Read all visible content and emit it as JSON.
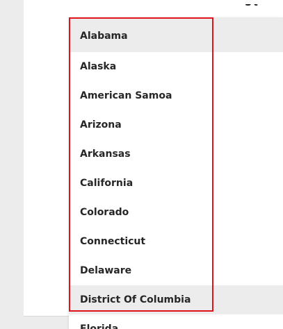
{
  "top_fragment_text": "St",
  "dropdown": {
    "options": [
      {
        "label": "Alabama"
      },
      {
        "label": "Alaska"
      },
      {
        "label": "American Samoa"
      },
      {
        "label": "Arizona"
      },
      {
        "label": "Arkansas"
      },
      {
        "label": "California"
      },
      {
        "label": "Colorado"
      },
      {
        "label": "Connecticut"
      },
      {
        "label": "Delaware"
      },
      {
        "label": "District Of Columbia"
      },
      {
        "label": "Florida"
      }
    ]
  },
  "colors": {
    "highlight_border": "#e0121a",
    "shaded_row": "#ececec",
    "text": "#262626"
  }
}
